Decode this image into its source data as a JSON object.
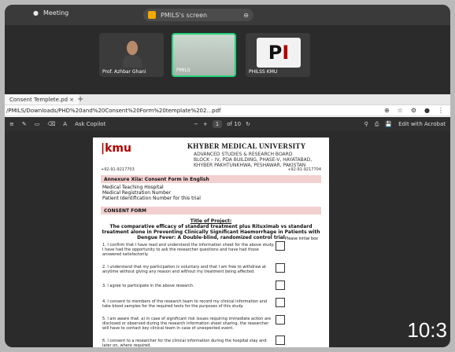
{
  "topbar": {
    "meeting_label": "Meeting",
    "share_label": "PMILS's screen"
  },
  "participants": [
    {
      "name": "Prof. Azhbar Ghani"
    },
    {
      "name": "PMILS"
    },
    {
      "name": "PHILSS KMU"
    }
  ],
  "browser": {
    "tab_label": "Consent Templete.pd ×",
    "address": "/PMILS/Downloads/PHD%20and%20Consent%20Form%20template%202...pdf"
  },
  "pdf_toolbar": {
    "ask_copilot": "Ask Copilot",
    "page_current": "1",
    "page_total": "of 10",
    "edit_label": "Edit with Acrobat"
  },
  "document": {
    "logo": "kmu",
    "university": "KHYBER MEDICAL UNIVERSITY",
    "subtitle": "ADVANCED STUDIES & RESEARCH BOARD",
    "address_line": "BLOCK – IV, PDA BUILDING, PHASE-V, HAYATABAD, KHYBER PAKHTUNKHWA, PESHAWAR, PAKISTAN",
    "phone_left": "+92-91-9217703",
    "phone_right": "+92-91-9217704",
    "annexure": "Annexure Xiia: Consent Form in English",
    "lines": [
      "Medical Teaching Hospital",
      "Medical Registration Number",
      "Patient Identification Number for this trial"
    ],
    "consent_header": "CONSENT FORM",
    "project_title_label": "Title of Project:",
    "project_title": "The comparative efficacy of standard treatment plus Rituximab vs standard treatment alone in Preventing Clinically Significant Haemorrhage in Patients with Dengue Fever: A Double-blind, randomized control trial",
    "please_initial": "Please initial box",
    "items": [
      "1. I confirm that I have read and understand the information sheet for the above study. I have had the opportunity to ask the researcher questions and have had those answered satisfactorily.",
      "2. I understand that my participation is voluntary and that I am free to withdraw at anytime without giving any reason and without my treatment being affected.",
      "3. I agree to participate in the above research.",
      "4. I consent to members of the research team to record my clinical information and take blood samples for the required tests for the purposes of this study.",
      "5. I am aware that: a) in case of significant risk issues requiring immediate action are disclosed or observed during the research information sheet sharing, the researcher will have to contact key clinical team in case of unexpected event.",
      "6. I consent to a researcher for the clinical information during the hospital stay and later on, where required."
    ]
  },
  "clock": "10:3"
}
